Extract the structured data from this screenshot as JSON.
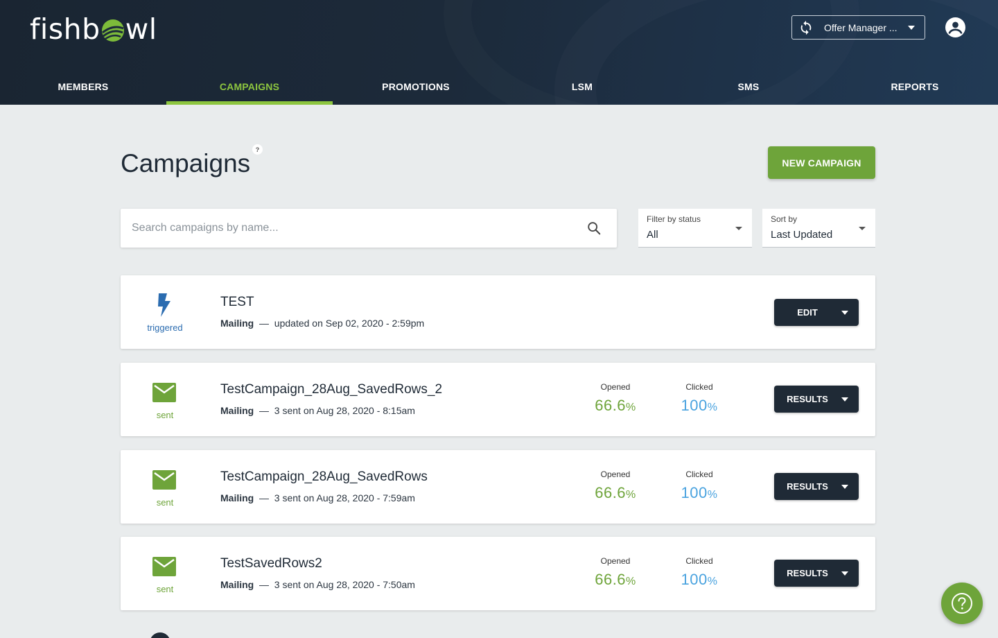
{
  "brand": {
    "logo_text_left": "fishb",
    "logo_text_right": "wl",
    "accent": "#8dc63f",
    "button_green": "#6ea43a",
    "dark": "#1f2a36"
  },
  "header": {
    "org_selector": {
      "label": "Offer Manager ...",
      "icon": "sync-icon"
    },
    "account_icon": "account-circle-icon"
  },
  "nav": {
    "items": [
      {
        "label": "MEMBERS"
      },
      {
        "label": "CAMPAIGNS",
        "active": true
      },
      {
        "label": "PROMOTIONS"
      },
      {
        "label": "LSM"
      },
      {
        "label": "SMS"
      },
      {
        "label": "REPORTS"
      }
    ]
  },
  "page": {
    "title": "Campaigns",
    "help_badge": "?",
    "new_button": "NEW CAMPAIGN"
  },
  "search": {
    "placeholder": "Search campaigns by name..."
  },
  "filters": {
    "status": {
      "label": "Filter by status",
      "value": "All"
    },
    "sort": {
      "label": "Sort by",
      "value": "Last Updated"
    }
  },
  "campaigns": [
    {
      "status": "triggered",
      "icon": "lightning-icon",
      "name": "TEST",
      "type": "Mailing",
      "dash": "—",
      "detail": "updated on Sep 02, 2020 - 2:59pm",
      "action": "EDIT"
    },
    {
      "status": "sent",
      "icon": "envelope-icon",
      "name": "TestCampaign_28Aug_SavedRows_2",
      "type": "Mailing",
      "dash": "—",
      "detail": "3 sent on Aug 28, 2020 - 8:15am",
      "opened_label": "Opened",
      "opened": "66.6",
      "clicked_label": "Clicked",
      "clicked": "100",
      "pct": "%",
      "action": "RESULTS"
    },
    {
      "status": "sent",
      "icon": "envelope-icon",
      "name": "TestCampaign_28Aug_SavedRows",
      "type": "Mailing",
      "dash": "—",
      "detail": "3 sent on Aug 28, 2020 - 7:59am",
      "opened_label": "Opened",
      "opened": "66.6",
      "clicked_label": "Clicked",
      "clicked": "100",
      "pct": "%",
      "action": "RESULTS"
    },
    {
      "status": "sent",
      "icon": "envelope-icon",
      "name": "TestSavedRows2",
      "type": "Mailing",
      "dash": "—",
      "detail": "3 sent on Aug 28, 2020 - 7:50am",
      "opened_label": "Opened",
      "opened": "66.6",
      "clicked_label": "Clicked",
      "clicked": "100",
      "pct": "%",
      "action": "RESULTS"
    }
  ],
  "help_fab": {
    "icon": "help-circle-icon"
  }
}
